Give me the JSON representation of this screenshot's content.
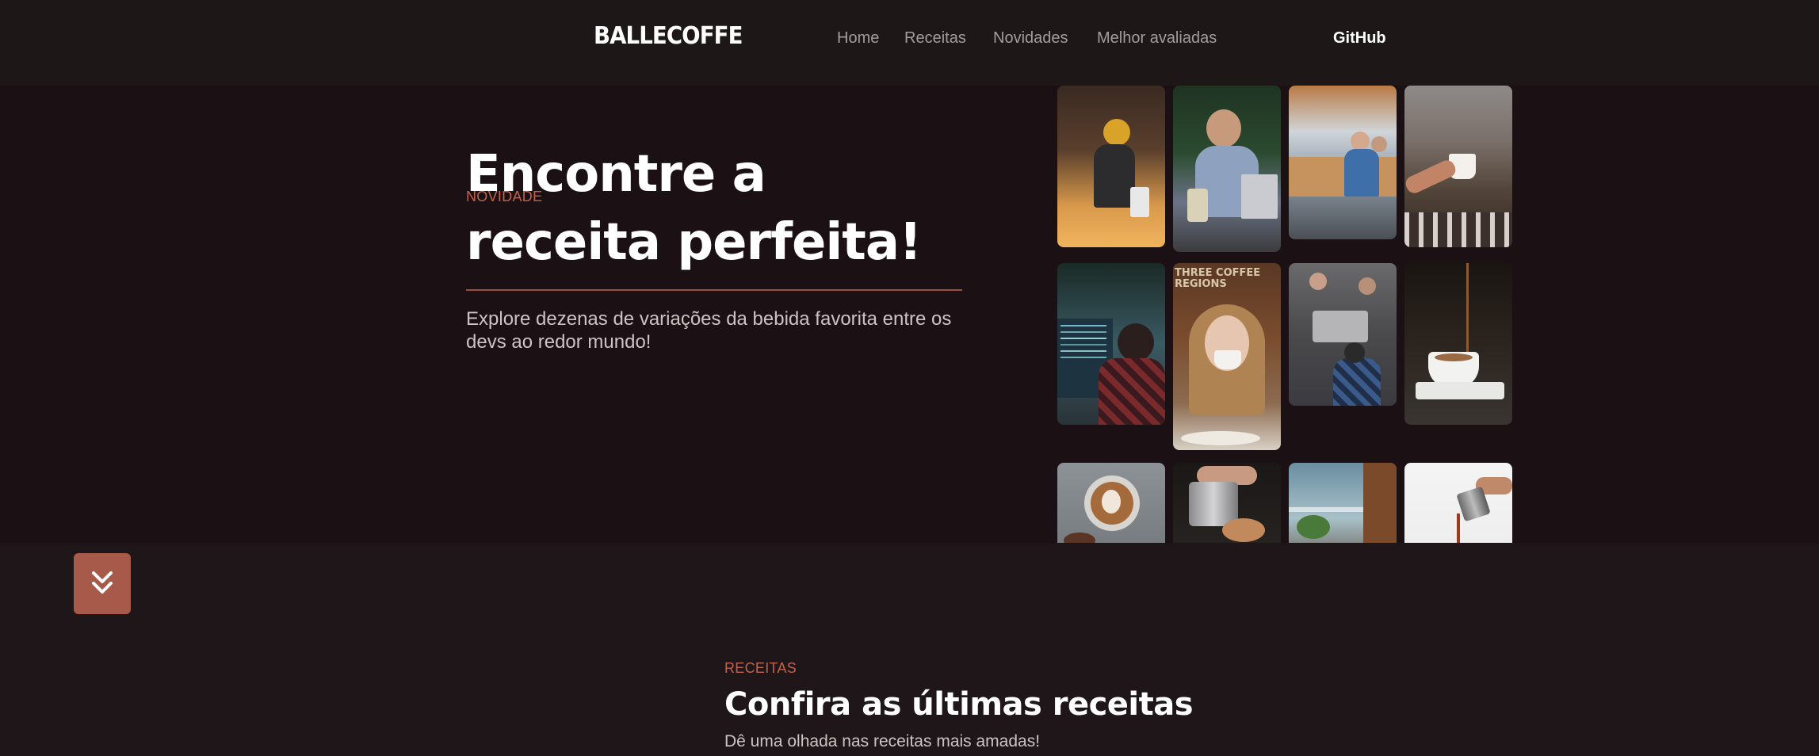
{
  "header": {
    "logo": "BALLECOFFE",
    "nav": [
      {
        "label": "Home"
      },
      {
        "label": "Receitas"
      },
      {
        "label": "Novidades"
      },
      {
        "label": "Melhor avaliadas"
      }
    ],
    "github": "GitHub"
  },
  "hero": {
    "eyebrow": "NOVIDADE",
    "title_line1": "Encontre a",
    "title_line2": "receita perfeita!",
    "description": "Explore dezenas de variações da bebida favorita entre os devs ao redor mundo!"
  },
  "gallery": {
    "photos": [
      {
        "name": "photo-barista-woman"
      },
      {
        "name": "photo-man-laptop"
      },
      {
        "name": "photo-office-people"
      },
      {
        "name": "photo-hand-mug"
      },
      {
        "name": "photo-dev-coding"
      },
      {
        "name": "photo-woman-drinking"
      },
      {
        "name": "photo-baristas-working"
      },
      {
        "name": "photo-pouring-cup"
      },
      {
        "name": "photo-latte-art"
      },
      {
        "name": "photo-milk-pitcher"
      },
      {
        "name": "photo-window-plants"
      },
      {
        "name": "photo-pouring-coffee"
      }
    ]
  },
  "scroll_button": {
    "icon": "double-chevron-down-icon"
  },
  "recipes_section": {
    "eyebrow": "RECEITAS",
    "title": "Confira as últimas receitas",
    "description": "Dê uma olhada nas receitas mais amadas!"
  },
  "colors": {
    "background": "#1b1114",
    "accent": "#c0624c",
    "button": "#a85a4a"
  }
}
